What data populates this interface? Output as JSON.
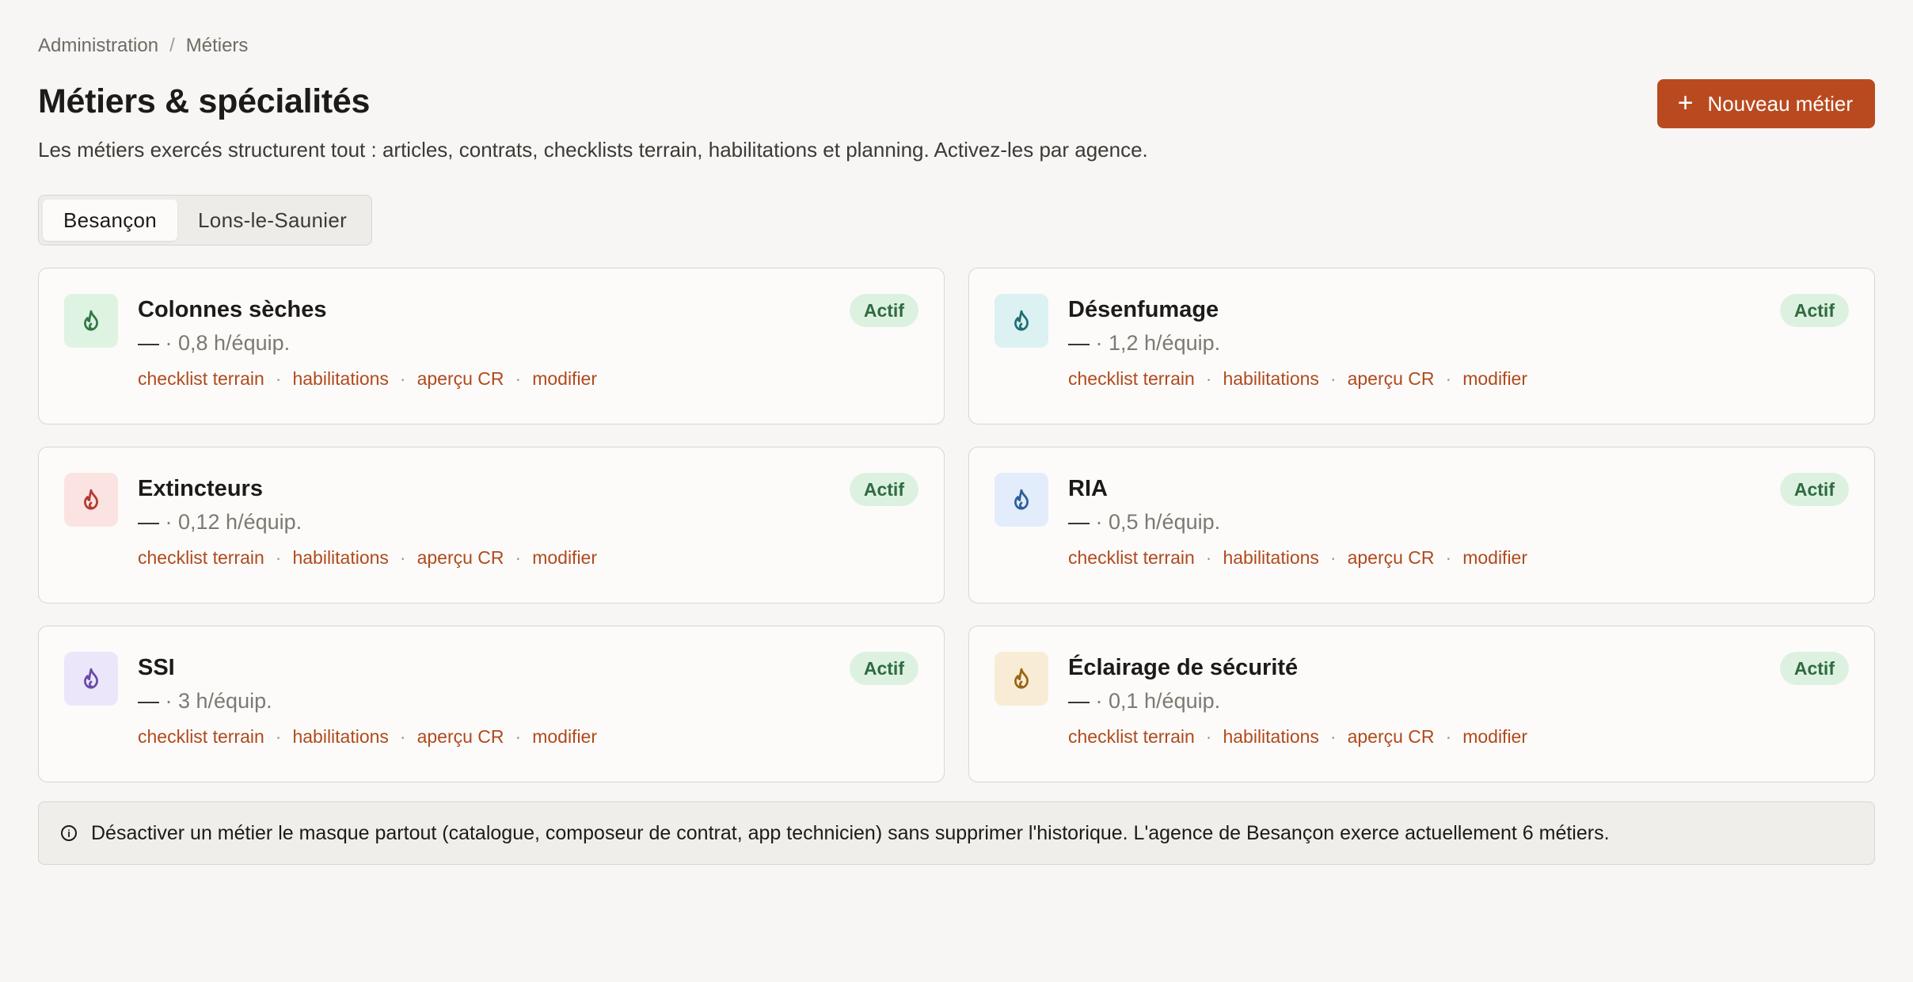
{
  "breadcrumb": {
    "root": "Administration",
    "separator": "/",
    "current": "Métiers"
  },
  "header": {
    "title": "Métiers & spécialités",
    "new_button_icon": "+",
    "new_button_label": "Nouveau métier",
    "subtitle": "Les métiers exercés structurent tout : articles, contrats, checklists terrain, habilitations et planning. Activez-les par agence."
  },
  "tabs": [
    {
      "label": "Besançon",
      "active": true
    },
    {
      "label": "Lons-le-Saunier",
      "active": false
    }
  ],
  "link_labels": {
    "checklist": "checklist terrain",
    "habilitations": "habilitations",
    "apercu": "aperçu CR",
    "modifier": "modifier",
    "separator": "·"
  },
  "cards": [
    {
      "name": "Colonnes sèches",
      "dash": "—",
      "meta": "· 0,8 h/équip.",
      "status": "Actif",
      "icon": "flame-icon",
      "icon_bg": "#dff3e3",
      "icon_color": "#2f7a45"
    },
    {
      "name": "Désenfumage",
      "dash": "—",
      "meta": "· 1,2 h/équip.",
      "status": "Actif",
      "icon": "flame-icon",
      "icon_bg": "#dcf1f2",
      "icon_color": "#1f6f73"
    },
    {
      "name": "Extincteurs",
      "dash": "—",
      "meta": "· 0,12 h/équip.",
      "status": "Actif",
      "icon": "flame-icon",
      "icon_bg": "#fbe3e2",
      "icon_color": "#b33a32"
    },
    {
      "name": "RIA",
      "dash": "—",
      "meta": "· 0,5 h/équip.",
      "status": "Actif",
      "icon": "flame-icon",
      "icon_bg": "#e2ecfa",
      "icon_color": "#2d5f98"
    },
    {
      "name": "SSI",
      "dash": "—",
      "meta": "· 3 h/équip.",
      "status": "Actif",
      "icon": "flame-icon",
      "icon_bg": "#ece6fa",
      "icon_color": "#6a4aa8"
    },
    {
      "name": "Éclairage de sécurité",
      "dash": "—",
      "meta": "· 0,1 h/équip.",
      "status": "Actif",
      "icon": "flame-icon",
      "icon_bg": "#f8ecd6",
      "icon_color": "#9a6512"
    }
  ],
  "note": {
    "icon": "info-icon",
    "text": "Désactiver un métier le masque partout (catalogue, composeur de contrat, app technicien) sans supprimer l'historique. L'agence de Besançon exerce actuellement 6 métiers."
  },
  "colors": {
    "accent": "#b94a1f",
    "badge_bg": "#ddf1e1",
    "badge_text": "#2e6b3f"
  }
}
